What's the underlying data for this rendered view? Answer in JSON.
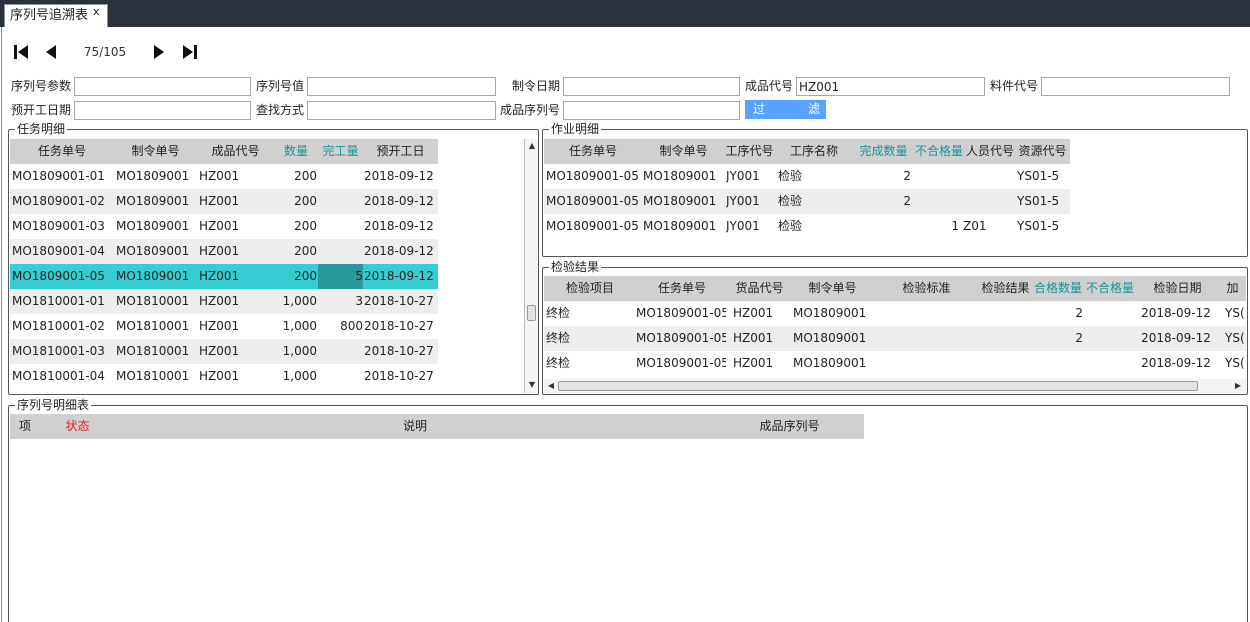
{
  "window": {
    "tab_title": "序列号追溯表",
    "tab_close": "x"
  },
  "nav": {
    "page_indicator": "75/105"
  },
  "filters": {
    "serial_param_label": "序列号参数",
    "serial_param_value": "",
    "serial_value_label": "序列号值",
    "serial_value_value": "",
    "order_date_label": "制令日期",
    "order_date_value": "",
    "product_code_label": "成品代号",
    "product_code_value": "HZ001",
    "part_code_label": "料件代号",
    "part_code_value": "",
    "planned_start_label": "预开工日期",
    "planned_start_value": "",
    "search_mode_label": "查找方式",
    "search_mode_value": "",
    "product_serial_label": "成品序列号",
    "product_serial_value": "",
    "filter_button_a": "过",
    "filter_button_b": "滤"
  },
  "tasks": {
    "title": "任务明细",
    "headers": [
      "任务单号",
      "制令单号",
      "成品代号",
      "数量",
      "完工量",
      "预开工日"
    ],
    "rows": [
      {
        "task": "MO1809001-01",
        "order": "MO1809001",
        "product": "HZ001",
        "qty": "200",
        "done": "",
        "start": "2018-09-12"
      },
      {
        "task": "MO1809001-02",
        "order": "MO1809001",
        "product": "HZ001",
        "qty": "200",
        "done": "",
        "start": "2018-09-12"
      },
      {
        "task": "MO1809001-03",
        "order": "MO1809001",
        "product": "HZ001",
        "qty": "200",
        "done": "",
        "start": "2018-09-12"
      },
      {
        "task": "MO1809001-04",
        "order": "MO1809001",
        "product": "HZ001",
        "qty": "200",
        "done": "",
        "start": "2018-09-12"
      },
      {
        "task": "MO1809001-05",
        "order": "MO1809001",
        "product": "HZ001",
        "qty": "200",
        "done": "5",
        "start": "2018-09-12"
      },
      {
        "task": "MO1810001-01",
        "order": "MO1810001",
        "product": "HZ001",
        "qty": "1,000",
        "done": "3",
        "start": "2018-10-27"
      },
      {
        "task": "MO1810001-02",
        "order": "MO1810001",
        "product": "HZ001",
        "qty": "1,000",
        "done": "800",
        "start": "2018-10-27"
      },
      {
        "task": "MO1810001-03",
        "order": "MO1810001",
        "product": "HZ001",
        "qty": "1,000",
        "done": "",
        "start": "2018-10-27"
      },
      {
        "task": "MO1810001-04",
        "order": "MO1810001",
        "product": "HZ001",
        "qty": "1,000",
        "done": "",
        "start": "2018-10-27"
      }
    ],
    "selected_row": 4
  },
  "operations": {
    "title": "作业明细",
    "headers": [
      "任务单号",
      "制令单号",
      "工序代号",
      "工序名称",
      "完成数量",
      "不合格量",
      "人员代号",
      "资源代号"
    ],
    "rows": [
      {
        "task": "MO1809001-05",
        "order": "MO1809001",
        "proc_code": "JY001",
        "proc_name": "检验",
        "done": "2",
        "ng": "",
        "person": "",
        "resource": "YS01-5"
      },
      {
        "task": "MO1809001-05",
        "order": "MO1809001",
        "proc_code": "JY001",
        "proc_name": "检验",
        "done": "2",
        "ng": "",
        "person": "",
        "resource": "YS01-5"
      },
      {
        "task": "MO1809001-05",
        "order": "MO1809001",
        "proc_code": "JY001",
        "proc_name": "检验",
        "done": "",
        "ng": "1",
        "person": "Z01",
        "resource": "YS01-5"
      }
    ]
  },
  "inspection": {
    "title": "检验结果",
    "headers": [
      "检验项目",
      "任务单号",
      "货品代号",
      "制令单号",
      "检验标准",
      "检验结果",
      "合格数量",
      "不合格量",
      "检验日期",
      "加"
    ],
    "rows": [
      {
        "item": "终检",
        "task": "MO1809001-05",
        "goods": "HZ001",
        "order": "MO1809001",
        "standard": "",
        "result": "",
        "pass": "2",
        "ng": "",
        "date": "2018-09-12",
        "extra": "YS("
      },
      {
        "item": "终检",
        "task": "MO1809001-05",
        "goods": "HZ001",
        "order": "MO1809001",
        "standard": "",
        "result": "",
        "pass": "2",
        "ng": "",
        "date": "2018-09-12",
        "extra": "YS("
      },
      {
        "item": "终检",
        "task": "MO1809001-05",
        "goods": "HZ001",
        "order": "MO1809001",
        "standard": "",
        "result": "",
        "pass": "",
        "ng": "",
        "date": "2018-09-12",
        "extra": "YS("
      }
    ]
  },
  "serials": {
    "title": "序列号明细表",
    "headers": [
      "项",
      "状态",
      "说明",
      "成品序列号"
    ],
    "rows": []
  },
  "icons": {
    "first": "skip-first-icon",
    "prev": "prev-icon",
    "next": "next-icon",
    "last": "skip-last-icon"
  },
  "colors": {
    "tab_bar": "#2b323c",
    "selection": "#36ccd1",
    "selected_cell": "#289a9e",
    "filter_button": "#5aa2ff",
    "teal_header": "#1a9299",
    "red_header": "#e0201c"
  }
}
